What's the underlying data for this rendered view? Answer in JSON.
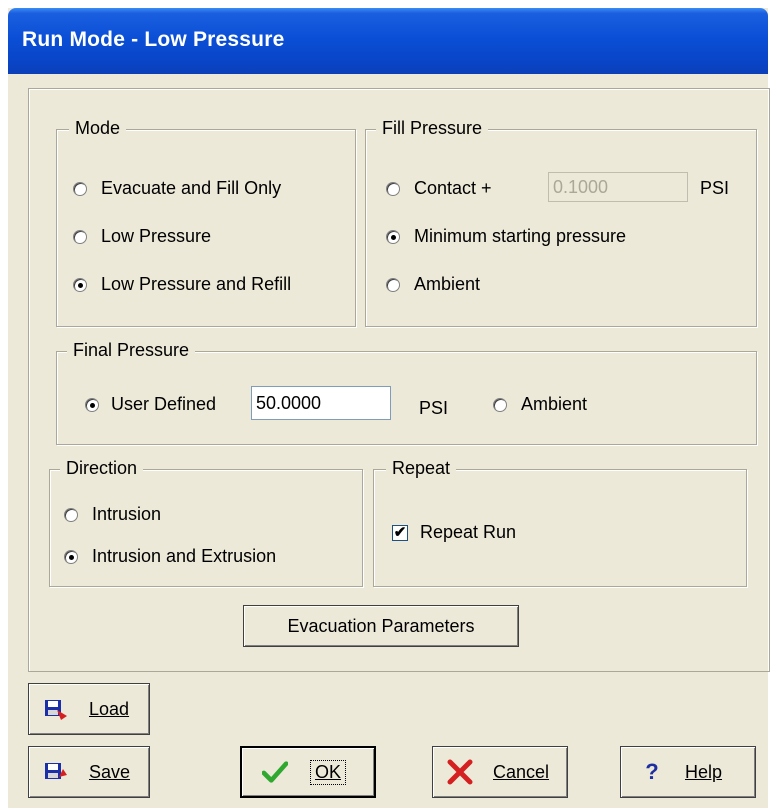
{
  "window": {
    "title": "Run Mode - Low Pressure"
  },
  "mode": {
    "legend": "Mode",
    "options": [
      {
        "label": "Evacuate and Fill Only",
        "selected": false
      },
      {
        "label": "Low Pressure",
        "selected": false
      },
      {
        "label": "Low Pressure and Refill",
        "selected": true
      }
    ]
  },
  "fill_pressure": {
    "legend": "Fill Pressure",
    "contact_label": "Contact +",
    "contact_value": "0.1000",
    "contact_unit": "PSI",
    "minimum_label": "Minimum  starting pressure",
    "ambient_label": "Ambient",
    "selected": "minimum"
  },
  "final_pressure": {
    "legend": "Final Pressure",
    "user_defined_label": "User Defined",
    "value": "50.0000",
    "unit": "PSI",
    "ambient_label": "Ambient",
    "selected": "user_defined"
  },
  "direction": {
    "legend": "Direction",
    "options": [
      {
        "label": "Intrusion",
        "selected": false
      },
      {
        "label": "Intrusion and Extrusion",
        "selected": true
      }
    ]
  },
  "repeat": {
    "legend": "Repeat",
    "label": "Repeat Run",
    "checked": true
  },
  "buttons": {
    "evacuation": "Evacuation Parameters",
    "load": "Load",
    "save": "Save",
    "ok": "OK",
    "cancel": "Cancel",
    "help": "Help"
  },
  "icons": {
    "load": "floppy-load-icon",
    "save": "floppy-save-icon",
    "ok": "green-check-icon",
    "cancel": "red-x-icon",
    "help": "question-mark-icon"
  },
  "colors": {
    "titlebar": "#0a4fd6",
    "dialog_bg": "#ece9d8",
    "check": "#2fa82f",
    "cancel": "#d42020",
    "help": "#1f2fa0"
  }
}
